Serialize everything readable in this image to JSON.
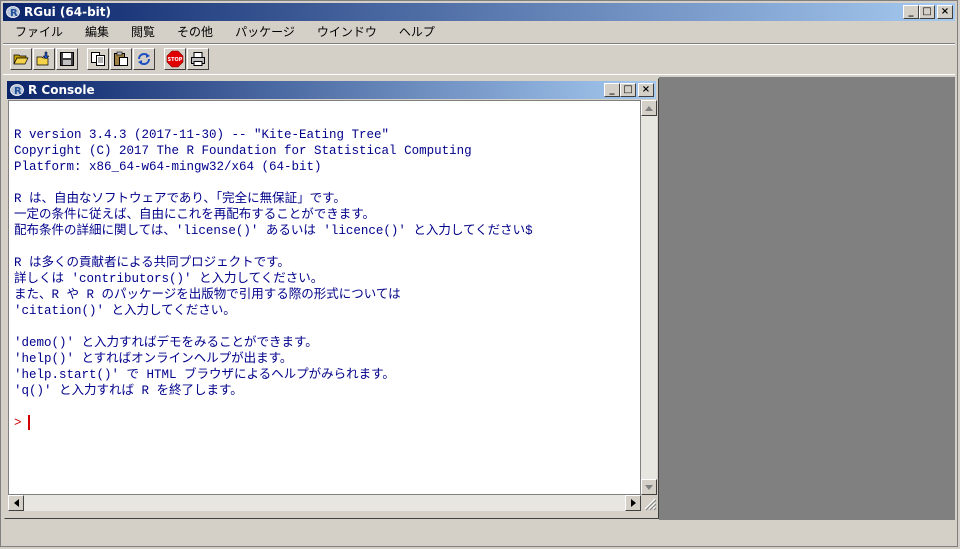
{
  "app": {
    "title": "RGui (64-bit)",
    "window_buttons": {
      "minimize": "_",
      "maximize": "□",
      "close": "×"
    }
  },
  "menu": [
    {
      "label": "ファイル"
    },
    {
      "label": "編集"
    },
    {
      "label": "閲覧"
    },
    {
      "label": "その他"
    },
    {
      "label": "パッケージ"
    },
    {
      "label": "ウインドウ"
    },
    {
      "label": "ヘルプ"
    }
  ],
  "toolbar": [
    {
      "icon": "open-script-icon"
    },
    {
      "icon": "load-workspace-icon"
    },
    {
      "icon": "save-workspace-icon"
    },
    {
      "icon": "copy-icon"
    },
    {
      "icon": "paste-icon"
    },
    {
      "icon": "copy-paste-icon"
    },
    {
      "icon": "stop-icon",
      "label": "STOP"
    },
    {
      "icon": "print-icon"
    }
  ],
  "console": {
    "title": "R Console",
    "lines": [
      "R version 3.4.3 (2017-11-30) -- \"Kite-Eating Tree\"",
      "Copyright (C) 2017 The R Foundation for Statistical Computing",
      "Platform: x86_64-w64-mingw32/x64 (64-bit)",
      "",
      "R は、自由なソフトウェアであり、「完全に無保証」です。",
      "一定の条件に従えば、自由にこれを再配布することができます。",
      "配布条件の詳細に関しては、'license()' あるいは 'licence()' と入力してください$",
      "",
      "R は多くの貢献者による共同プロジェクトです。",
      "詳しくは 'contributors()' と入力してください。",
      "また、R や R のパッケージを出版物で引用する際の形式については",
      "'citation()' と入力してください。",
      "",
      "'demo()' と入力すればデモをみることができます。",
      "'help()' とすればオンラインヘルプが出ます。",
      "'help.start()' で HTML ブラウザによるヘルプがみられます。",
      "'q()' と入力すれば R を終了します。",
      ""
    ],
    "prompt": ">"
  },
  "colors": {
    "output_text": "#00008b",
    "prompt": "#d00000",
    "title_start": "#0a246a",
    "title_end": "#a6caf0"
  }
}
